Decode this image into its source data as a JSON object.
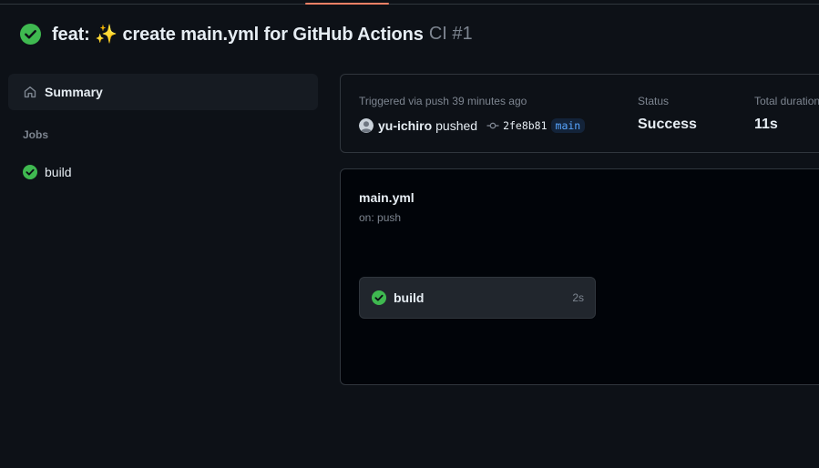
{
  "header": {
    "title": "feat: ✨ create main.yml for GitHub Actions",
    "run_suffix": "CI #1"
  },
  "sidebar": {
    "summary_label": "Summary",
    "jobs_heading": "Jobs",
    "jobs": [
      {
        "label": "build",
        "status": "success"
      }
    ]
  },
  "summary": {
    "trigger_text": "Triggered via push 39 minutes ago",
    "actor": "yu-ichiro",
    "action": "pushed",
    "commit_sha": "2fe8b81",
    "branch": "main",
    "status_label": "Status",
    "status_value": "Success",
    "duration_label": "Total duration",
    "duration_value": "11s"
  },
  "workflow": {
    "file_name": "main.yml",
    "trigger": "on: push",
    "jobs": [
      {
        "label": "build",
        "duration": "2s",
        "status": "success"
      }
    ]
  },
  "icons": {
    "status": "check-circle-fill-icon",
    "home": "home-icon",
    "commit": "git-commit-icon",
    "avatar": "user-avatar"
  },
  "colors": {
    "background": "#0d1117",
    "success": "#3fb950",
    "accent_link": "#58a6ff",
    "tab_underline": "#f78166"
  }
}
